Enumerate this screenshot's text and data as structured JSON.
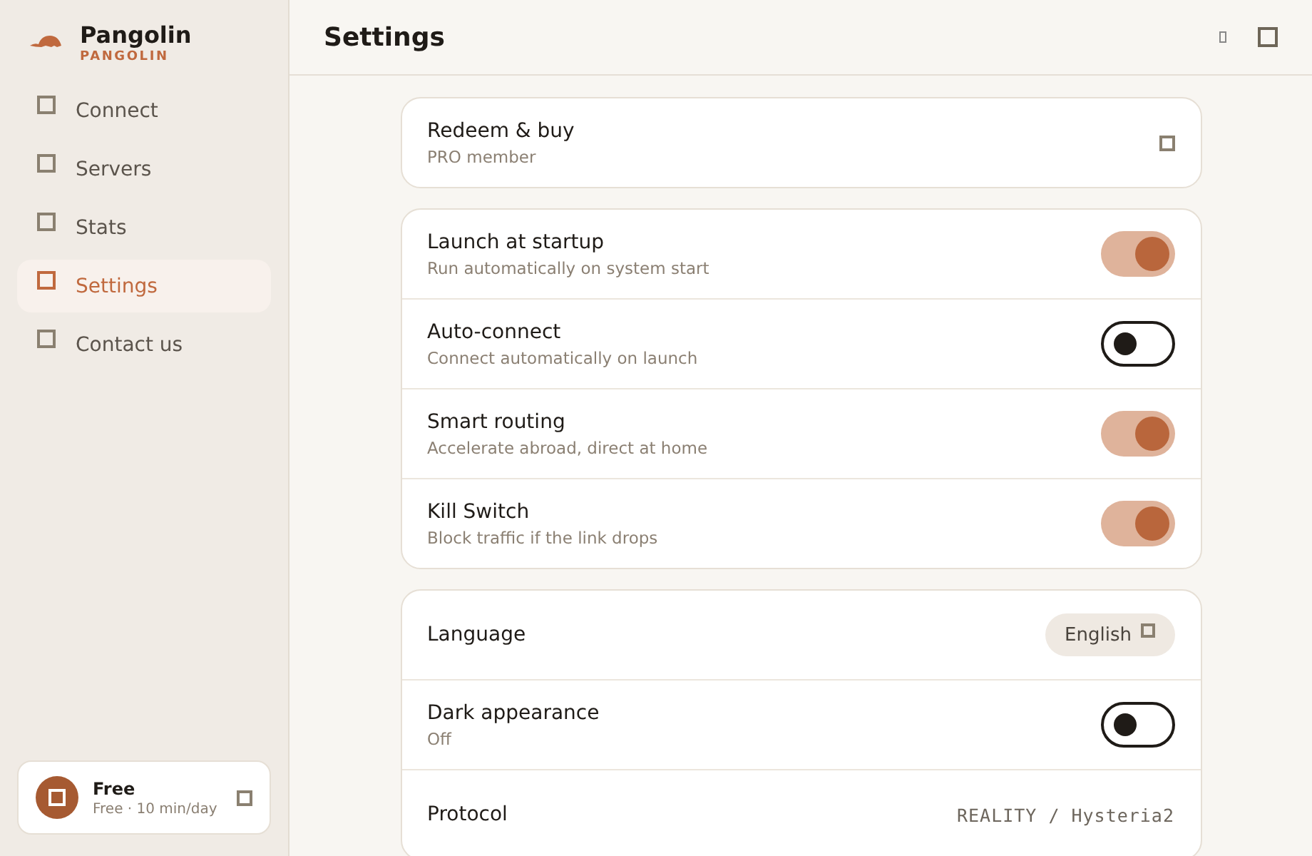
{
  "app": {
    "name": "Pangolin",
    "subtitle": "PANGOLIN"
  },
  "nav": [
    {
      "label": "Connect",
      "selected": false
    },
    {
      "label": "Servers",
      "selected": false
    },
    {
      "label": "Stats",
      "selected": false
    },
    {
      "label": "Settings",
      "selected": true
    },
    {
      "label": "Contact us",
      "selected": false
    }
  ],
  "account": {
    "plan": "Free",
    "detail": "Free · 10 min/day"
  },
  "header": {
    "title": "Settings"
  },
  "groups": [
    {
      "rows": [
        {
          "kind": "link",
          "title": "Redeem & buy",
          "subtitle": "PRO member"
        }
      ]
    },
    {
      "rows": [
        {
          "kind": "toggle",
          "title": "Launch at startup",
          "subtitle": "Run automatically on system start",
          "on": true
        },
        {
          "kind": "toggle",
          "title": "Auto-connect",
          "subtitle": "Connect automatically on launch",
          "on": false
        },
        {
          "kind": "toggle",
          "title": "Smart routing",
          "subtitle": "Accelerate abroad, direct at home",
          "on": true
        },
        {
          "kind": "toggle",
          "title": "Kill Switch",
          "subtitle": "Block traffic if the link drops",
          "on": true
        }
      ]
    },
    {
      "rows": [
        {
          "kind": "select",
          "title": "Language",
          "value": "English"
        },
        {
          "kind": "toggle",
          "title": "Dark appearance",
          "subtitle": "Off",
          "on": false
        },
        {
          "kind": "value",
          "title": "Protocol",
          "value": "REALITY / Hysteria2"
        }
      ]
    }
  ]
}
